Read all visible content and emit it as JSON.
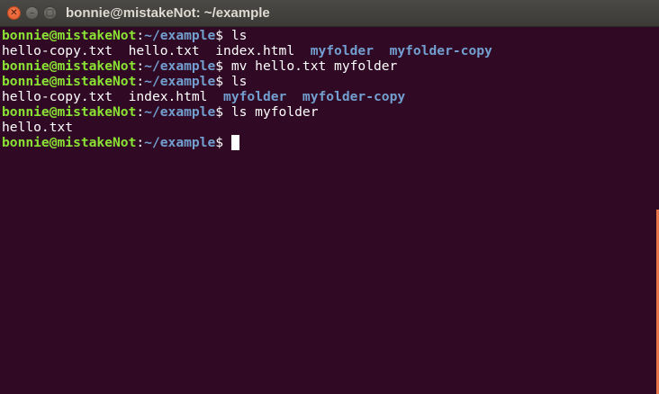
{
  "window": {
    "title": "bonnie@mistakeNot: ~/example",
    "controls": {
      "close_glyph": "✕",
      "minimize_glyph": "–",
      "maximize_glyph": "□"
    }
  },
  "prompt": {
    "user_host": "bonnie@mistakeNot",
    "separator": ":",
    "path": "~/example",
    "symbol": "$ "
  },
  "lines": {
    "l1": {
      "command": "ls"
    },
    "l2": {
      "file1": "hello-copy.txt",
      "gap1": "  ",
      "file2": "hello.txt",
      "gap2": "  ",
      "file3": "index.html",
      "gap3": "  ",
      "dir1": "myfolder",
      "gap4": "  ",
      "dir2": "myfolder-copy"
    },
    "l3": {
      "command": "mv hello.txt myfolder"
    },
    "l4": {
      "command": "ls"
    },
    "l5": {
      "file1": "hello-copy.txt",
      "gap1": "  ",
      "file2": "index.html",
      "gap2": "  ",
      "dir1": "myfolder",
      "gap3": "  ",
      "dir2": "myfolder-copy"
    },
    "l6": {
      "command": "ls myfolder"
    },
    "l7": {
      "file1": "hello.txt"
    },
    "l8": {
      "command": ""
    }
  },
  "colors": {
    "background": "#300a24",
    "prompt_user": "#8ae234",
    "prompt_path": "#729fcf",
    "directory": "#729fcf",
    "text": "#ffffff",
    "titlebar": "#3c3b37",
    "close_button": "#e35d2e",
    "scrollbar": "#e9764a"
  }
}
